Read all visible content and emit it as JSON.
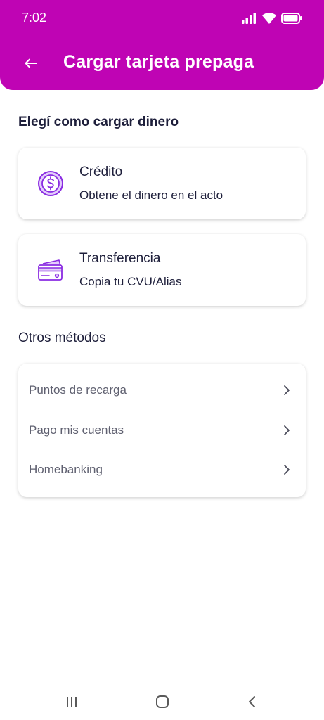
{
  "status_bar": {
    "time": "7:02",
    "icons": [
      "signal-icon",
      "wifi-icon",
      "battery-icon"
    ]
  },
  "header": {
    "back_icon": "arrow-left-icon",
    "title": "Cargar tarjeta prepaga"
  },
  "load_section": {
    "title": "Elegí como cargar dinero",
    "options": [
      {
        "icon": "dollar-coin-icon",
        "title": "Crédito",
        "subtitle": "Obtene el dinero en el acto"
      },
      {
        "icon": "credit-card-icon",
        "title": "Transferencia",
        "subtitle": "Copia tu CVU/Alias"
      }
    ]
  },
  "other_section": {
    "title": "Otros métodos",
    "items": [
      {
        "label": "Puntos de recarga",
        "icon": "chevron-right-icon"
      },
      {
        "label": "Pago mis cuentas",
        "icon": "chevron-right-icon"
      },
      {
        "label": "Homebanking",
        "icon": "chevron-right-icon"
      }
    ]
  },
  "nav_bar": {
    "buttons": [
      "recent-apps-icon",
      "home-icon",
      "back-icon"
    ]
  },
  "colors": {
    "brand": "#bf04b4",
    "icon_accent": "#8a2be2",
    "text_dark": "#1e1f3b",
    "text_muted": "#5f6070"
  }
}
